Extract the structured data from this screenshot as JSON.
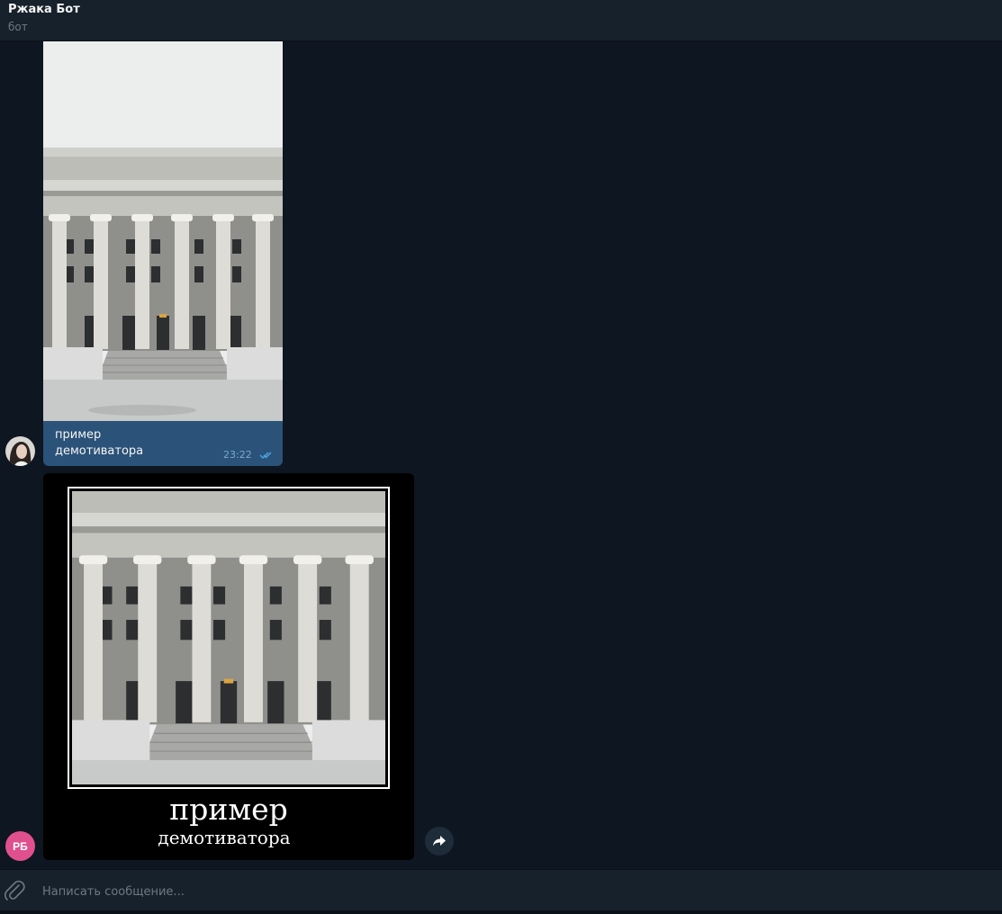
{
  "header": {
    "title": "Ржака Бот",
    "subtitle": "бот"
  },
  "messages": [
    {
      "direction": "outgoing",
      "image": "building-photo",
      "caption_line1": "пример",
      "caption_line2": "демотиватора",
      "time": "23:22",
      "status_icon": "double-check-icon"
    },
    {
      "direction": "incoming",
      "image": "demotivator-building-photo",
      "image_text_line1": "пример",
      "image_text_line2": "демотиватора"
    }
  ],
  "bot_avatar": {
    "initials": "РБ",
    "color": "#e0508f"
  },
  "forward_button_icon": "forward-arrow-icon",
  "composer": {
    "placeholder": "Написать сообщение...",
    "attach_icon": "paperclip-icon"
  },
  "colors": {
    "background": "#0e1621",
    "header": "#17212b",
    "outgoing_bubble": "#2b5278",
    "tick_color": "#4fa3e6"
  }
}
